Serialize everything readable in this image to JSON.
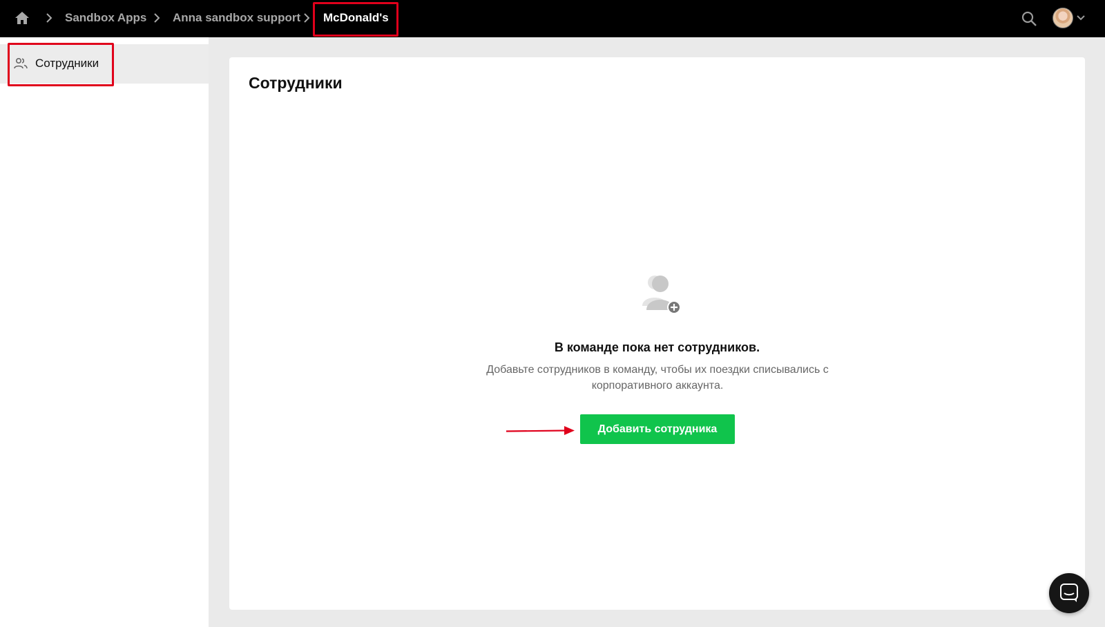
{
  "breadcrumbs": {
    "items": [
      "Sandbox Apps",
      "Anna sandbox support"
    ],
    "current": "McDonald's"
  },
  "sidebar": {
    "items": [
      {
        "label": "Сотрудники",
        "icon": "people-icon",
        "active": true
      }
    ]
  },
  "main": {
    "title": "Сотрудники",
    "empty_state": {
      "title": "В команде пока нет сотрудников.",
      "description_line1": "Добавьте сотрудников в команду, чтобы их поездки списывались с",
      "description_line2": "корпоративного аккаунта.",
      "button_label": "Добавить сотрудника"
    }
  },
  "colors": {
    "topbar": "#000000",
    "accent_green": "#10c44c",
    "highlight_red": "#e0001b"
  },
  "icons": [
    "home-icon",
    "chevron-right-icon",
    "search-icon",
    "chevron-down-icon",
    "people-icon",
    "add-person-icon",
    "chat-icon"
  ]
}
